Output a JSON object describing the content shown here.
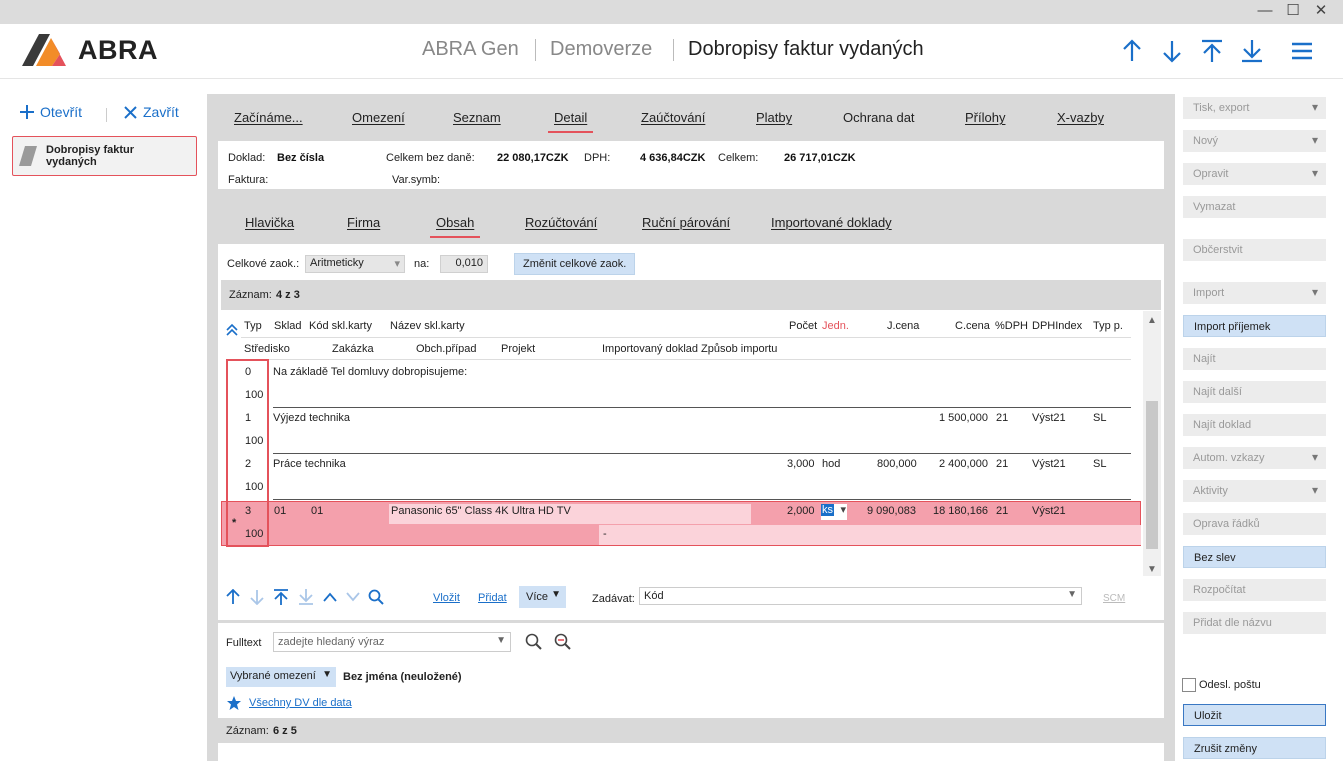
{
  "window": {
    "minimize": "—",
    "maximize": "☐",
    "close": "✕"
  },
  "header": {
    "brand": "ABRA",
    "app": "ABRA Gen",
    "db": "Demoverze",
    "title": "Dobropisy faktur vydaných",
    "nav_icons": [
      "arrow-up-icon",
      "arrow-down-icon",
      "arrow-first-icon",
      "arrow-last-icon",
      "hamburger-menu-icon"
    ]
  },
  "left": {
    "open_label": "Otevřít",
    "close_label": "Zavřít",
    "doc_item": "Dobropisy faktur vydaných"
  },
  "main_tabs": [
    "Začínáme...",
    "Omezení",
    "Seznam",
    "Detail",
    "Zaúčtování",
    "Platby",
    "Ochrana dat",
    "Přílohy",
    "X-vazby"
  ],
  "info": {
    "doklad_label": "Doklad:",
    "doklad_value": "Bez čísla",
    "celkem_bez_dane_label": "Celkem bez daně:",
    "celkem_bez_dane_value": "22 080,17CZK",
    "dph_label": "DPH:",
    "dph_value": "4 636,84CZK",
    "celkem_label": "Celkem:",
    "celkem_value": "26 717,01CZK",
    "faktura_label": "Faktura:",
    "varsymb_label": "Var.symb:"
  },
  "sub_tabs": [
    "Hlavička",
    "Firma",
    "Obsah",
    "Rozúčtování",
    "Ruční párování",
    "Importované doklady"
  ],
  "rounding": {
    "label": "Celkové zaok.:",
    "mode": "Aritmeticky",
    "na_label": "na:",
    "na_value": "0,010",
    "change_button": "Změnit celkové zaok."
  },
  "records": {
    "label": "Záznam:",
    "value": "4 z 3"
  },
  "columns_row1": [
    "Typ",
    "Sklad",
    "Kód skl.karty",
    "Název skl.karty",
    "Počet",
    "Jedn.",
    "J.cena",
    "C.cena",
    "%DPH",
    "DPHIndex",
    "Typ p."
  ],
  "columns_row2": [
    "Středisko",
    "Zakázka",
    "Obch.případ",
    "Projekt",
    "Importovaný doklad",
    "Způsob importu"
  ],
  "rows": [
    {
      "typ": "0",
      "stredisko": "100",
      "text": "Na základě Tel domluvy dobropisujeme:",
      "pocet": "",
      "jedn": "",
      "jcena": "",
      "ccena": "",
      "dph": "",
      "dphindex": "",
      "typp": ""
    },
    {
      "typ": "1",
      "stredisko": "100",
      "text": "Výjezd technika",
      "pocet": "",
      "jedn": "",
      "jcena": "",
      "ccena": "1 500,000",
      "dph": "21",
      "dphindex": "Výst21",
      "typp": "SL"
    },
    {
      "typ": "2",
      "stredisko": "100",
      "text": "Práce technika",
      "pocet": "3,000",
      "jedn": "hod",
      "jcena": "800,000",
      "ccena": "2 400,000",
      "dph": "21",
      "dphindex": "Výst21",
      "typp": "SL"
    },
    {
      "typ": "3",
      "stredisko": "100",
      "sklad": "01",
      "kod": "01",
      "text": "Panasonic 65\" Class 4K Ultra HD TV",
      "pocet": "2,000",
      "jedn": "ks",
      "jcena": "9 090,083",
      "ccena": "18 180,166",
      "dph": "21",
      "dphindex": "Výst21",
      "typp": "",
      "importovany": "-"
    }
  ],
  "grid_toolbar": {
    "vlozit": "Vložit",
    "pridat": "Přidat",
    "vice": "Více",
    "zadavat_label": "Zadávat:",
    "zadavat_value": "Kód",
    "scm": "SCM"
  },
  "fulltext": {
    "label": "Fulltext",
    "placeholder": "zadejte hledaný výraz",
    "omezeni_combo": "Vybrané omezení",
    "omezeni_value": "Bez jména (neuložené)",
    "favorite_link": "Všechny DV dle data"
  },
  "records2": {
    "label": "Záznam:",
    "value": "6 z 5"
  },
  "right_buttons": [
    {
      "label": "Tisk, export",
      "dd": true,
      "state": "disabled"
    },
    {
      "label": "Nový",
      "dd": true,
      "state": "disabled"
    },
    {
      "label": "Opravit",
      "dd": true,
      "state": "disabled"
    },
    {
      "label": "Vymazat",
      "dd": false,
      "state": "disabled"
    },
    {
      "label": "Občerstvit",
      "dd": false,
      "state": "disabled"
    },
    {
      "label": "Import",
      "dd": true,
      "state": "disabled"
    },
    {
      "label": "Import příjemek",
      "dd": false,
      "state": "active"
    },
    {
      "label": "Najít",
      "dd": false,
      "state": "disabled"
    },
    {
      "label": "Najít další",
      "dd": false,
      "state": "disabled"
    },
    {
      "label": "Najít doklad",
      "dd": false,
      "state": "disabled"
    },
    {
      "label": "Autom. vzkazy",
      "dd": true,
      "state": "disabled"
    },
    {
      "label": "Aktivity",
      "dd": true,
      "state": "disabled"
    },
    {
      "label": "Oprava řádků",
      "dd": false,
      "state": "disabled"
    },
    {
      "label": "Bez slev",
      "dd": false,
      "state": "active"
    },
    {
      "label": "Rozpočítat",
      "dd": false,
      "state": "disabled"
    },
    {
      "label": "Přidat dle názvu",
      "dd": false,
      "state": "disabled"
    }
  ],
  "odesl_postu": "Odesl. poštu",
  "ulozit": "Uložit",
  "zrusit": "Zrušit změny",
  "colors": {
    "accent": "#1a6fc9",
    "highlight_row": "#f4a0ac",
    "red": "#e4525b",
    "orange": "#f28c28"
  }
}
